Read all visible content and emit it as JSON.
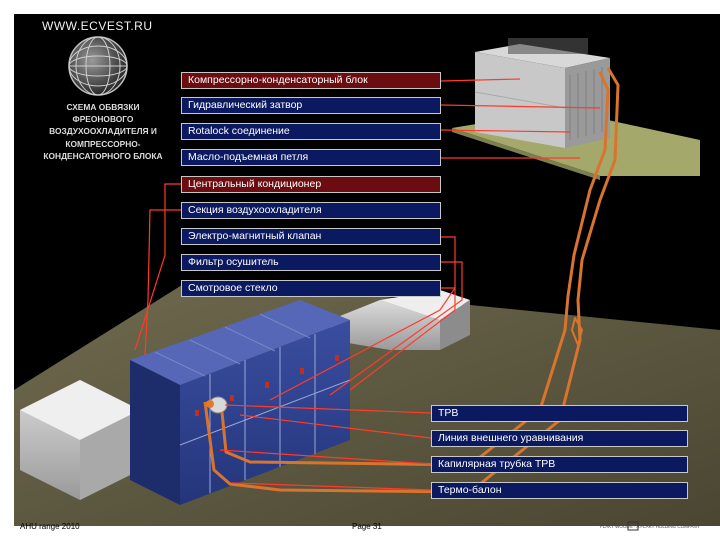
{
  "site": "WWW.ECVEST.RU",
  "title_lines": [
    "СХЕМА ОБВЯЗКИ",
    "ФРЕОНОВОГО",
    "ВОЗДУХООХЛАДИТЕЛЯ И",
    "КОМПРЕССОРНО-",
    "КОНДЕНСАТОРНОГО БЛОКА"
  ],
  "labels_top": [
    {
      "text": "Компрессорно-конденсаторный блок",
      "style": "red"
    },
    {
      "text": "Гидравлический затвор",
      "style": "blue"
    },
    {
      "text": "Rotalock соединение",
      "style": "blue"
    },
    {
      "text": "Масло-подъемная петля",
      "style": "blue"
    },
    {
      "text": "Центральный кондиционер",
      "style": "red"
    },
    {
      "text": "Секция воздухоохладителя",
      "style": "blue"
    },
    {
      "text": "Электро-магнитный клапан",
      "style": "blue"
    },
    {
      "text": "Фильтр осушитель",
      "style": "blue"
    },
    {
      "text": "Смотровое стекло",
      "style": "blue"
    }
  ],
  "labels_bottom": [
    {
      "text": "ТРВ",
      "style": "blue"
    },
    {
      "text": "Линия внешнего уравнивания",
      "style": "blue"
    },
    {
      "text": "Капилярная трубка ТРВ",
      "style": "blue"
    },
    {
      "text": "Термо-балон",
      "style": "blue"
    }
  ],
  "footer": {
    "left": "AHU range 2010",
    "center": "Page 31",
    "right": "FLÄKT WOODS · A FLÄKT HOLDING COMPANY"
  },
  "colors": {
    "background": "#000000",
    "label_blue": "#0b1960",
    "label_red": "#6a0c10",
    "pipe": "#d9742e",
    "unit_blue": "#2d3f8c"
  }
}
